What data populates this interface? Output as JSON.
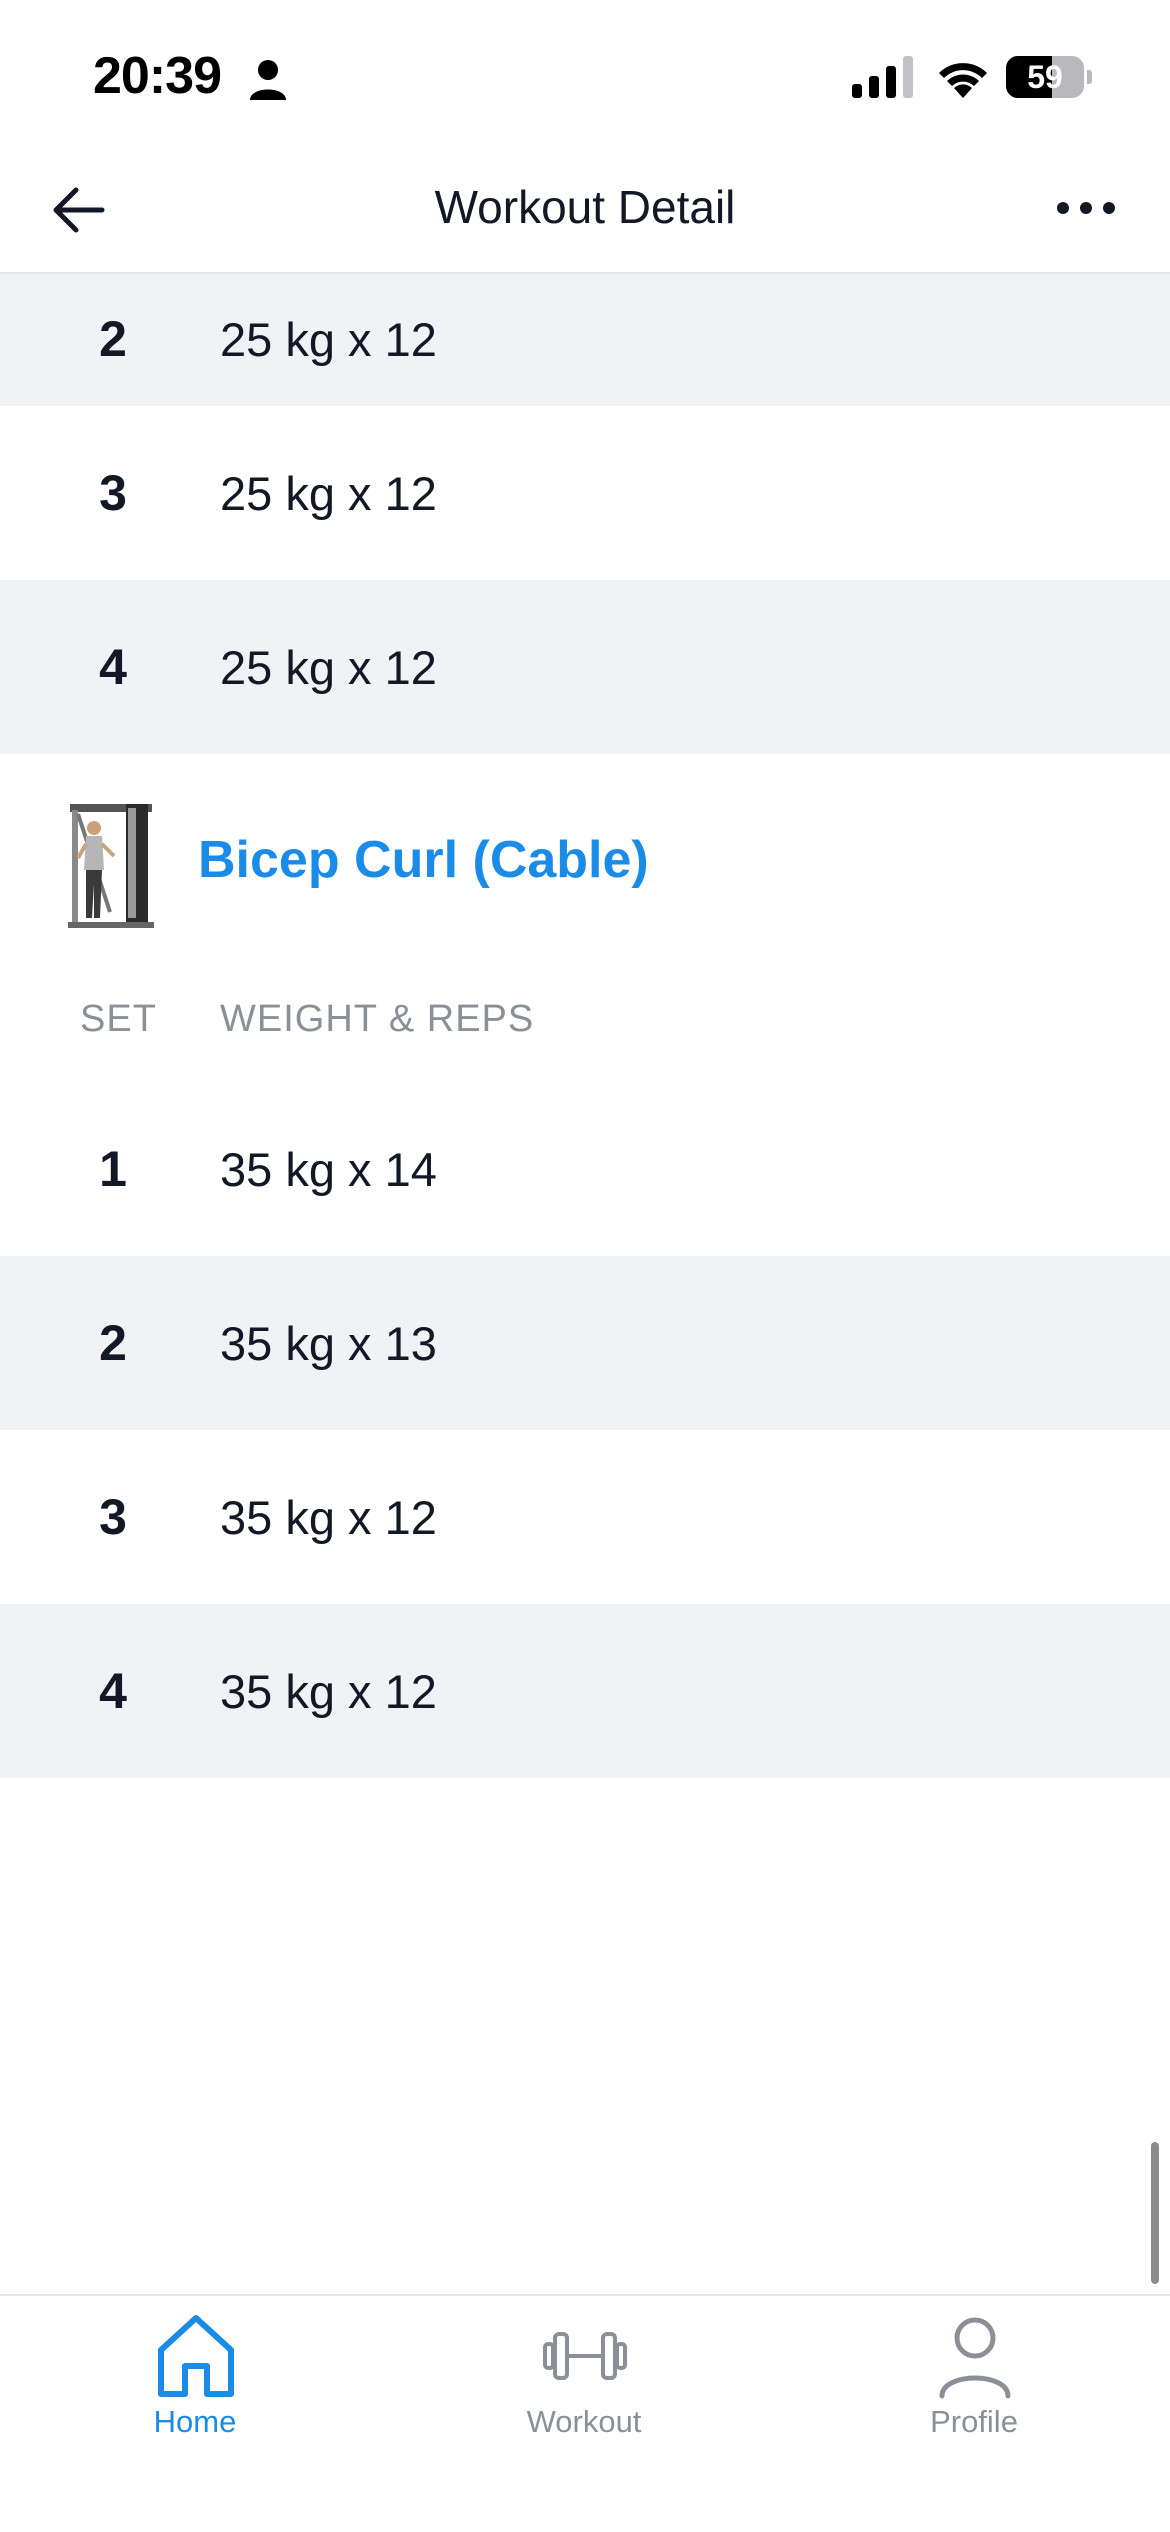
{
  "status_bar": {
    "time": "20:39",
    "battery": "59"
  },
  "nav": {
    "title": "Workout Detail",
    "back_icon": "arrow-left-icon",
    "more_icon": "ellipsis-icon"
  },
  "previous_exercise": {
    "sets": [
      {
        "set": "2",
        "value": "25 kg x 12"
      },
      {
        "set": "3",
        "value": "25 kg x 12"
      },
      {
        "set": "4",
        "value": "25 kg x 12"
      }
    ]
  },
  "exercise": {
    "name": "Bicep Curl (Cable)",
    "thumbnail_icon": "cable-machine-icon",
    "columns": {
      "set": "SET",
      "weight_reps": "WEIGHT & REPS"
    },
    "sets": [
      {
        "set": "1",
        "value": "35 kg x 14"
      },
      {
        "set": "2",
        "value": "35 kg x 13"
      },
      {
        "set": "3",
        "value": "35 kg x 12"
      },
      {
        "set": "4",
        "value": "35 kg x 12"
      }
    ]
  },
  "tab_bar": {
    "home": "Home",
    "workout": "Workout",
    "profile": "Profile",
    "active": "home"
  },
  "colors": {
    "accent": "#1a8ce8",
    "row_shade": "#f1f2f6",
    "muted_text": "#8a8f98",
    "primary_text": "#121826"
  }
}
